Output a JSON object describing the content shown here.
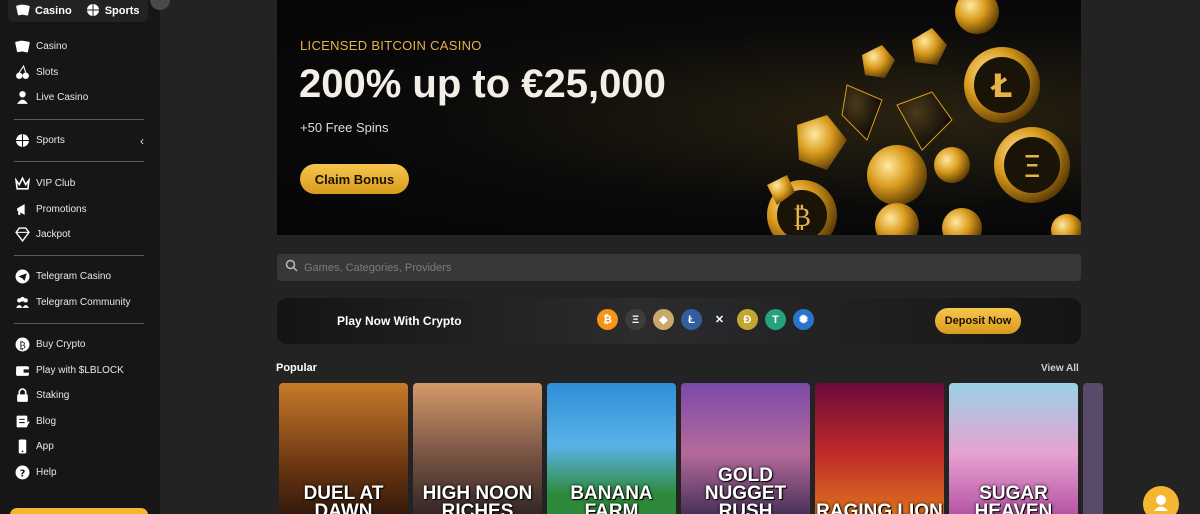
{
  "topswitch": {
    "casino": "Casino",
    "sports": "Sports"
  },
  "sidebar": {
    "group1": [
      {
        "label": "Casino",
        "icon": "cards-icon"
      },
      {
        "label": "Slots",
        "icon": "cherry-icon"
      },
      {
        "label": "Live Casino",
        "icon": "dealer-icon"
      }
    ],
    "sports": {
      "label": "Sports",
      "icon": "ball-icon"
    },
    "group3": [
      {
        "label": "VIP Club",
        "icon": "crown-icon"
      },
      {
        "label": "Promotions",
        "icon": "megaphone-icon"
      },
      {
        "label": "Jackpot",
        "icon": "diamond-icon"
      }
    ],
    "group4": [
      {
        "label": "Telegram Casino",
        "icon": "telegram-icon"
      },
      {
        "label": "Telegram Community",
        "icon": "people-icon"
      }
    ],
    "group5": [
      {
        "label": "Buy Crypto",
        "icon": "bitcoin-icon"
      },
      {
        "label": "Play with $LBLOCK",
        "icon": "wallet-icon"
      },
      {
        "label": "Staking",
        "icon": "lock-icon"
      },
      {
        "label": "Blog",
        "icon": "blog-icon"
      },
      {
        "label": "App",
        "icon": "phone-icon"
      },
      {
        "label": "Help",
        "icon": "help-icon"
      }
    ]
  },
  "hero": {
    "tag": "LICENSED BITCOIN CASINO",
    "headline": "200% up to €25,000",
    "sub": "+50 Free Spins",
    "cta": "Claim Bonus"
  },
  "search": {
    "placeholder": "Games, Categories, Providers"
  },
  "crypto": {
    "label": "Play Now With Crypto",
    "deposit": "Deposit Now",
    "coins": [
      {
        "symbol": "₿",
        "color": "#f7931a"
      },
      {
        "symbol": "Ξ",
        "color": "#3c3c3d"
      },
      {
        "symbol": "◆",
        "color": "#c8a96a"
      },
      {
        "symbol": "Ł",
        "color": "#345d9d"
      },
      {
        "symbol": "✕",
        "color": "#23292f"
      },
      {
        "symbol": "Ð",
        "color": "#c2a633"
      },
      {
        "symbol": "T",
        "color": "#26a17b"
      },
      {
        "symbol": "✺",
        "color": "#2775ca"
      }
    ]
  },
  "popular": {
    "title": "Popular",
    "view_all": "View All",
    "games": [
      {
        "name": "DUEL AT DAWN",
        "bg": "linear-gradient(#c77a2a,#6a3512 60%,#2a1508)"
      },
      {
        "name": "HIGH NOON\nRICHES",
        "bg": "linear-gradient(#d49a6a,#7a5545 50%,#2a2020)"
      },
      {
        "name": "BANANA FARM",
        "bg": "linear-gradient(#2e8ed8,#5ab2e6 45%,#2e8a3a 80%)"
      },
      {
        "name": "GOLD NUGGET\nRUSH",
        "bg": "linear-gradient(#7a4aa8,#b56a9a 50%,#3a2a50)"
      },
      {
        "name": "RAGING LION",
        "bg": "linear-gradient(#6a0a3a,#c02a2a 50%,#e07a1a)"
      },
      {
        "name": "SUGAR HEAVEN",
        "bg": "linear-gradient(#9ad2e6,#e6a2d0 50%,#b04aa0)"
      }
    ]
  }
}
